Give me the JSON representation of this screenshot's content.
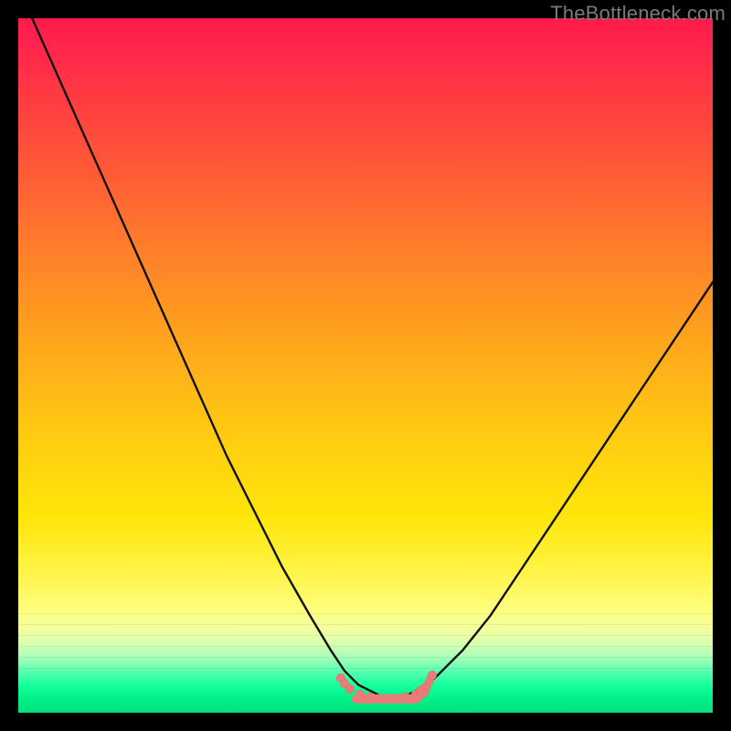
{
  "watermark": "TheBottleneck.com",
  "colors": {
    "marker": "#eb7b78",
    "curve": "#111111"
  },
  "chart_data": {
    "type": "line",
    "title": "",
    "xlabel": "",
    "ylabel": "",
    "xlim": [
      0,
      100
    ],
    "ylim": [
      0,
      100
    ],
    "grid": false,
    "legend": false,
    "annotations": [],
    "series": [
      {
        "name": "bottleneck-curve",
        "x": [
          2,
          6,
          10,
          14,
          18,
          22,
          26,
          30,
          34,
          38,
          42,
          45,
          47,
          49,
          51,
          53,
          55,
          57,
          60,
          64,
          68,
          72,
          76,
          80,
          84,
          88,
          92,
          96,
          100
        ],
        "values": [
          100,
          91,
          82,
          73,
          64,
          55,
          46,
          37,
          29,
          21,
          14,
          9,
          6,
          4,
          3,
          2,
          2,
          3,
          5,
          9,
          14,
          20,
          26,
          32,
          38,
          44,
          50,
          56,
          62
        ]
      }
    ],
    "markers": [
      {
        "x": 46.5,
        "y": 5.0,
        "r": 5
      },
      {
        "x": 47.0,
        "y": 4.2,
        "r": 5
      },
      {
        "x": 47.8,
        "y": 3.4,
        "r": 5
      },
      {
        "x": 49.2,
        "y": 2.6,
        "r": 5
      },
      {
        "x": 50.8,
        "y": 2.2,
        "r": 5
      },
      {
        "x": 52.5,
        "y": 2.0,
        "r": 5
      },
      {
        "x": 54.2,
        "y": 2.0,
        "r": 5
      },
      {
        "x": 55.8,
        "y": 2.2,
        "r": 5
      },
      {
        "x": 57.3,
        "y": 2.6,
        "r": 5
      },
      {
        "x": 58.2,
        "y": 3.0,
        "r": 7
      },
      {
        "x": 58.8,
        "y": 3.8,
        "r": 5
      },
      {
        "x": 59.2,
        "y": 4.6,
        "r": 5
      },
      {
        "x": 59.6,
        "y": 5.4,
        "r": 5
      }
    ],
    "bar_marker": {
      "x": 53,
      "y": 2.0,
      "w": 10,
      "h": 1.4
    }
  }
}
